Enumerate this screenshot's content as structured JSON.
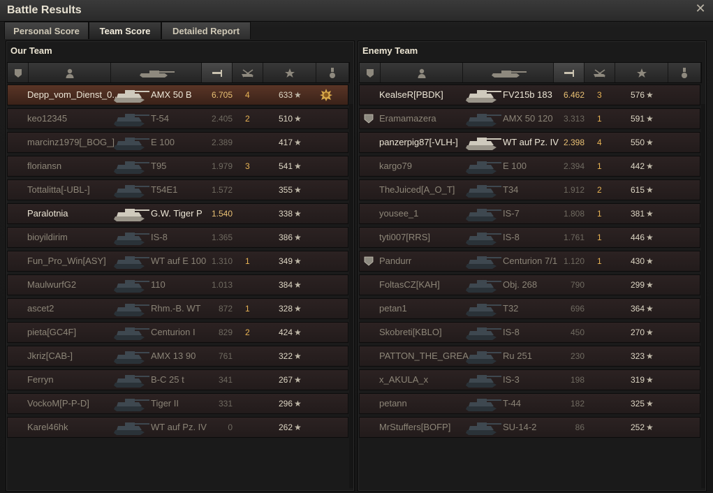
{
  "window": {
    "title": "Battle Results"
  },
  "tabs": [
    {
      "label": "Personal Score",
      "active": false
    },
    {
      "label": "Team Score",
      "active": true
    },
    {
      "label": "Detailed Report",
      "active": false
    }
  ],
  "our_team": {
    "title": "Our Team",
    "rows": [
      {
        "name": "Depp_vom_Dienst_0..",
        "vehicle": "AMX 50 B",
        "xp": "6.705",
        "kills": "4",
        "score": "633",
        "highlight": true,
        "medal": true
      },
      {
        "name": "keo12345",
        "vehicle": "T-54",
        "xp": "2.405",
        "kills": "2",
        "score": "510"
      },
      {
        "name": "marcinz1979[_BOG_]",
        "vehicle": "E 100",
        "xp": "2.389",
        "kills": "",
        "score": "417"
      },
      {
        "name": "floriansn",
        "vehicle": "T95",
        "xp": "1.979",
        "kills": "3",
        "score": "541"
      },
      {
        "name": "Tottalitta[-UBL-]",
        "vehicle": "T54E1",
        "xp": "1.572",
        "kills": "",
        "score": "355"
      },
      {
        "name": "Paralotnia",
        "vehicle": "G.W. Tiger P",
        "xp": "1.540",
        "kills": "",
        "score": "338",
        "alive": true
      },
      {
        "name": "bioyildirim",
        "vehicle": "IS-8",
        "xp": "1.365",
        "kills": "",
        "score": "386"
      },
      {
        "name": "Fun_Pro_Win[ASY]",
        "vehicle": "WT auf E 100",
        "xp": "1.310",
        "kills": "1",
        "score": "349"
      },
      {
        "name": "MaulwurfG2",
        "vehicle": "110",
        "xp": "1.013",
        "kills": "",
        "score": "384"
      },
      {
        "name": "ascet2",
        "vehicle": "Rhm.-B. WT",
        "xp": "872",
        "kills": "1",
        "score": "328"
      },
      {
        "name": "pieta[GC4F]",
        "vehicle": "Centurion I",
        "xp": "829",
        "kills": "2",
        "score": "424"
      },
      {
        "name": "Jkriz[CAB-]",
        "vehicle": "AMX 13 90",
        "xp": "761",
        "kills": "",
        "score": "322"
      },
      {
        "name": "Ferryn",
        "vehicle": "B-C 25 t",
        "xp": "341",
        "kills": "",
        "score": "267"
      },
      {
        "name": "VockoM[P-P-D]",
        "vehicle": "Tiger II",
        "xp": "331",
        "kills": "",
        "score": "296"
      },
      {
        "name": "Karel46hk",
        "vehicle": "WT auf Pz. IV",
        "xp": "0",
        "kills": "",
        "score": "262"
      }
    ]
  },
  "enemy_team": {
    "title": "Enemy Team",
    "rows": [
      {
        "name": "KealseR[PBDK]",
        "vehicle": "FV215b 183",
        "xp": "6.462",
        "kills": "3",
        "score": "576",
        "alive": true
      },
      {
        "name": "Eramamazera",
        "vehicle": "AMX 50 120",
        "xp": "3.313",
        "kills": "1",
        "score": "591",
        "badge": true
      },
      {
        "name": "panzerpig87[-VLH-]",
        "vehicle": "WT auf Pz. IV",
        "xp": "2.398",
        "kills": "4",
        "score": "550",
        "alive": true
      },
      {
        "name": "kargo79",
        "vehicle": "E 100",
        "xp": "2.394",
        "kills": "1",
        "score": "442"
      },
      {
        "name": "TheJuiced[A_O_T]",
        "vehicle": "T34",
        "xp": "1.912",
        "kills": "2",
        "score": "615"
      },
      {
        "name": "yousee_1",
        "vehicle": "IS-7",
        "xp": "1.808",
        "kills": "1",
        "score": "381"
      },
      {
        "name": "tyti007[RRS]",
        "vehicle": "IS-8",
        "xp": "1.761",
        "kills": "1",
        "score": "446"
      },
      {
        "name": "Pandurr",
        "vehicle": "Centurion 7/1",
        "xp": "1.120",
        "kills": "1",
        "score": "430",
        "badge": true
      },
      {
        "name": "FoltasCZ[KAH]",
        "vehicle": "Obj. 268",
        "xp": "790",
        "kills": "",
        "score": "299"
      },
      {
        "name": "petan1",
        "vehicle": "T32",
        "xp": "696",
        "kills": "",
        "score": "364"
      },
      {
        "name": "Skobreti[KBLO]",
        "vehicle": "IS-8",
        "xp": "450",
        "kills": "",
        "score": "270"
      },
      {
        "name": "PATTON_THE_GREA..",
        "vehicle": "Ru 251",
        "xp": "230",
        "kills": "",
        "score": "323"
      },
      {
        "name": "x_AKULA_x",
        "vehicle": "IS-3",
        "xp": "198",
        "kills": "",
        "score": "319"
      },
      {
        "name": "petann",
        "vehicle": "T-44",
        "xp": "182",
        "kills": "",
        "score": "325"
      },
      {
        "name": "MrStuffers[BOFP]",
        "vehicle": "SU-14-2",
        "xp": "86",
        "kills": "",
        "score": "252"
      }
    ]
  },
  "star_glyph": "★",
  "header_icons": [
    "squad-icon",
    "player-icon",
    "tank-icon",
    "damage-icon",
    "kills-icon",
    "star-icon",
    "medal-icon"
  ],
  "colors": {
    "highlight_row": "#5a3526",
    "xp_alive": "#e8c074",
    "kills": "#e8b455"
  }
}
